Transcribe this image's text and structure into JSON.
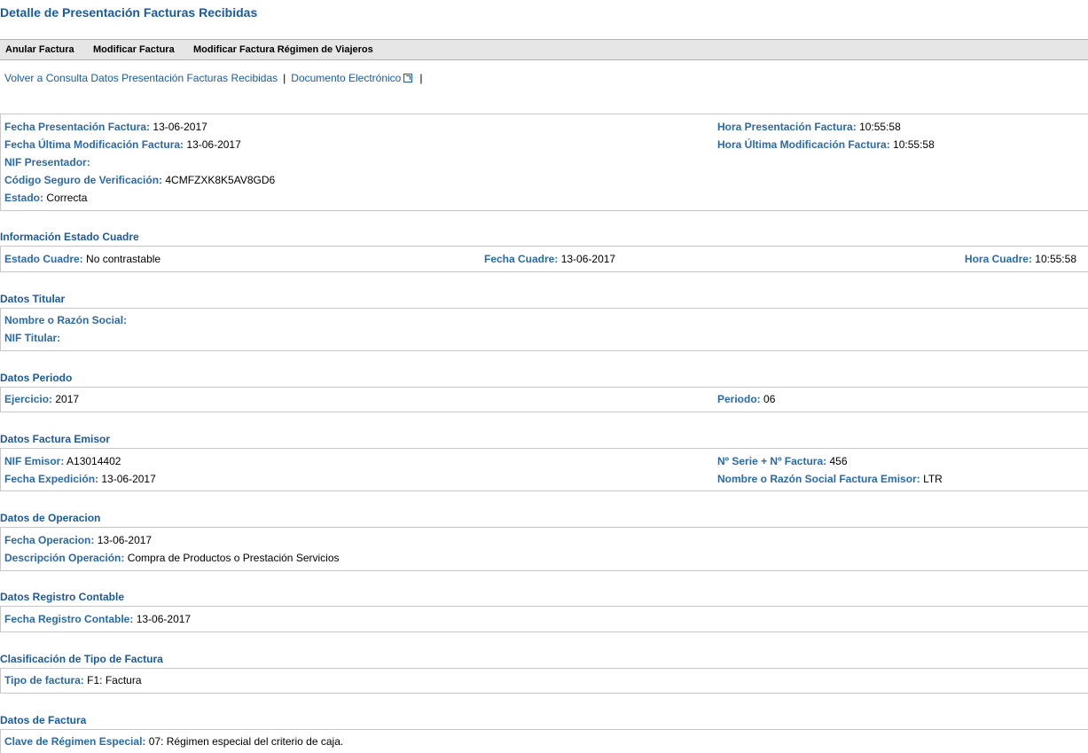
{
  "page": {
    "title": "Detalle de Presentación Facturas Recibidas"
  },
  "toolbar": {
    "anular": "Anular Factura",
    "modificar": "Modificar Factura",
    "modificar_viajeros": "Modificar Factura Régimen de Viajeros"
  },
  "links": {
    "volver": "Volver a Consulta Datos Presentación Facturas Recibidas",
    "sep": "|",
    "documento": "Documento Electrónico"
  },
  "presentacion": {
    "fecha_presentacion": {
      "label": "Fecha Presentación Factura:",
      "value": "13-06-2017"
    },
    "hora_presentacion": {
      "label": "Hora Presentación Factura:",
      "value": "10:55:58"
    },
    "fecha_modificacion": {
      "label": "Fecha Última Modificación Factura:",
      "value": "13-06-2017"
    },
    "hora_modificacion": {
      "label": "Hora Última Modificación Factura:",
      "value": "10:55:58"
    },
    "nif_presentador": {
      "label": "NIF Presentador:",
      "value": ""
    },
    "csv": {
      "label": "Código Seguro de Verificación:",
      "value": "4CMFZXK8K5AV8GD6"
    },
    "estado": {
      "label": "Estado:",
      "value": "Correcta"
    }
  },
  "cuadre": {
    "title": "Información Estado Cuadre",
    "estado": {
      "label": "Estado Cuadre:",
      "value": "No contrastable"
    },
    "fecha": {
      "label": "Fecha Cuadre:",
      "value": "13-06-2017"
    },
    "hora": {
      "label": "Hora Cuadre:",
      "value": "10:55:58"
    }
  },
  "titular": {
    "title": "Datos Titular",
    "nombre": {
      "label": "Nombre o Razón Social:",
      "value": ""
    },
    "nif": {
      "label": "NIF Titular:",
      "value": ""
    }
  },
  "periodo": {
    "title": "Datos Periodo",
    "ejercicio": {
      "label": "Ejercicio:",
      "value": "2017"
    },
    "periodo": {
      "label": "Periodo:",
      "value": "06"
    }
  },
  "emisor": {
    "title": "Datos Factura Emisor",
    "nif": {
      "label": "NIF Emisor:",
      "value": "A13014402"
    },
    "serie": {
      "label": "Nº Serie + Nº Factura:",
      "value": "456"
    },
    "fecha_expedicion": {
      "label": "Fecha Expedición:",
      "value": "13-06-2017"
    },
    "nombre": {
      "label": "Nombre o Razón Social Factura Emisor:",
      "value": "LTR"
    }
  },
  "operacion": {
    "title": "Datos de Operacion",
    "fecha": {
      "label": "Fecha Operacion:",
      "value": "13-06-2017"
    },
    "descripcion": {
      "label": "Descripción Operación:",
      "value": "Compra de Productos o Prestación Servicios"
    }
  },
  "registro": {
    "title": "Datos Registro Contable",
    "fecha": {
      "label": "Fecha Registro Contable:",
      "value": "13-06-2017"
    }
  },
  "clasificacion": {
    "title": "Clasificación de Tipo de Factura",
    "tipo": {
      "label": "Tipo de factura:",
      "value": "F1: Factura"
    }
  },
  "factura": {
    "title": "Datos de Factura",
    "clave": {
      "label": "Clave de Régimen Especial:",
      "value": "07: Régimen especial del criterio de caja."
    }
  },
  "colors": {
    "title": "#1a5a9e",
    "label": "#2a6aa8",
    "toolbar_bg": "#e6e6e6",
    "border": "#c8c8c8"
  },
  "icons": {
    "external_link": "external-link-icon"
  }
}
